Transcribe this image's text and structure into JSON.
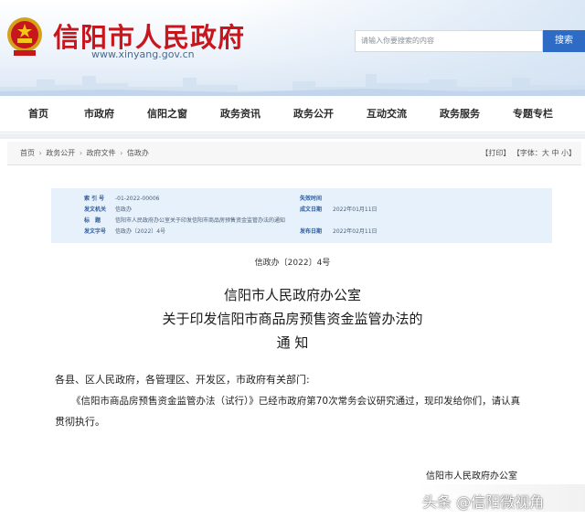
{
  "header": {
    "site_title": "信阳市人民政府",
    "site_url": "www.xinyang.gov.cn",
    "search_placeholder": "请输入你要搜索的内容",
    "search_button": "搜索"
  },
  "nav": {
    "items": [
      "首页",
      "市政府",
      "信阳之窗",
      "政务资讯",
      "政务公开",
      "互动交流",
      "政务服务",
      "专题专栏"
    ]
  },
  "breadcrumb": {
    "items": [
      "首页",
      "政务公开",
      "政府文件",
      "信政办"
    ],
    "separator": "›",
    "print": "【打印】",
    "font_size": "【字体：大 中 小】"
  },
  "meta": {
    "index_label": "索 引 号",
    "index_value": "-01-2022-00006",
    "expire_label": "失效时间",
    "expire_value": "",
    "issuer_label": "发文机关",
    "issuer_value": "信政办",
    "created_label": "成文日期",
    "created_value": "2022年01月11日",
    "subject_label": "标　题",
    "subject_value": "信阳市人民政府办公室关于印发信阳市商品房预售资金监管办法的通知",
    "docnum_label": "发文字号",
    "docnum_value": "信政办〔2022〕4号",
    "published_label": "发布日期",
    "published_value": "2022年02月11日"
  },
  "document": {
    "number": "信政办〔2022〕4号",
    "title_line1": "信阳市人民政府办公室",
    "title_line2": "关于印发信阳市商品房预售资金监管办法的",
    "title_line3": "通 知",
    "salutation": "各县、区人民政府，各管理区、开发区，市政府有关部门:",
    "para1_line1": "《信阳市商品房预售资金监管办法（试行）》已经市政府第70次常务会议研究通过，现印发给你们，请认真",
    "para1_line2": "贯彻执行。",
    "signature": "信阳市人民政府办公室"
  },
  "watermark": "头条 @信阳微视角",
  "colors": {
    "brand_red": "#c8161d",
    "search_blue": "#2e6bc4",
    "meta_bg": "#e7f1fb"
  }
}
